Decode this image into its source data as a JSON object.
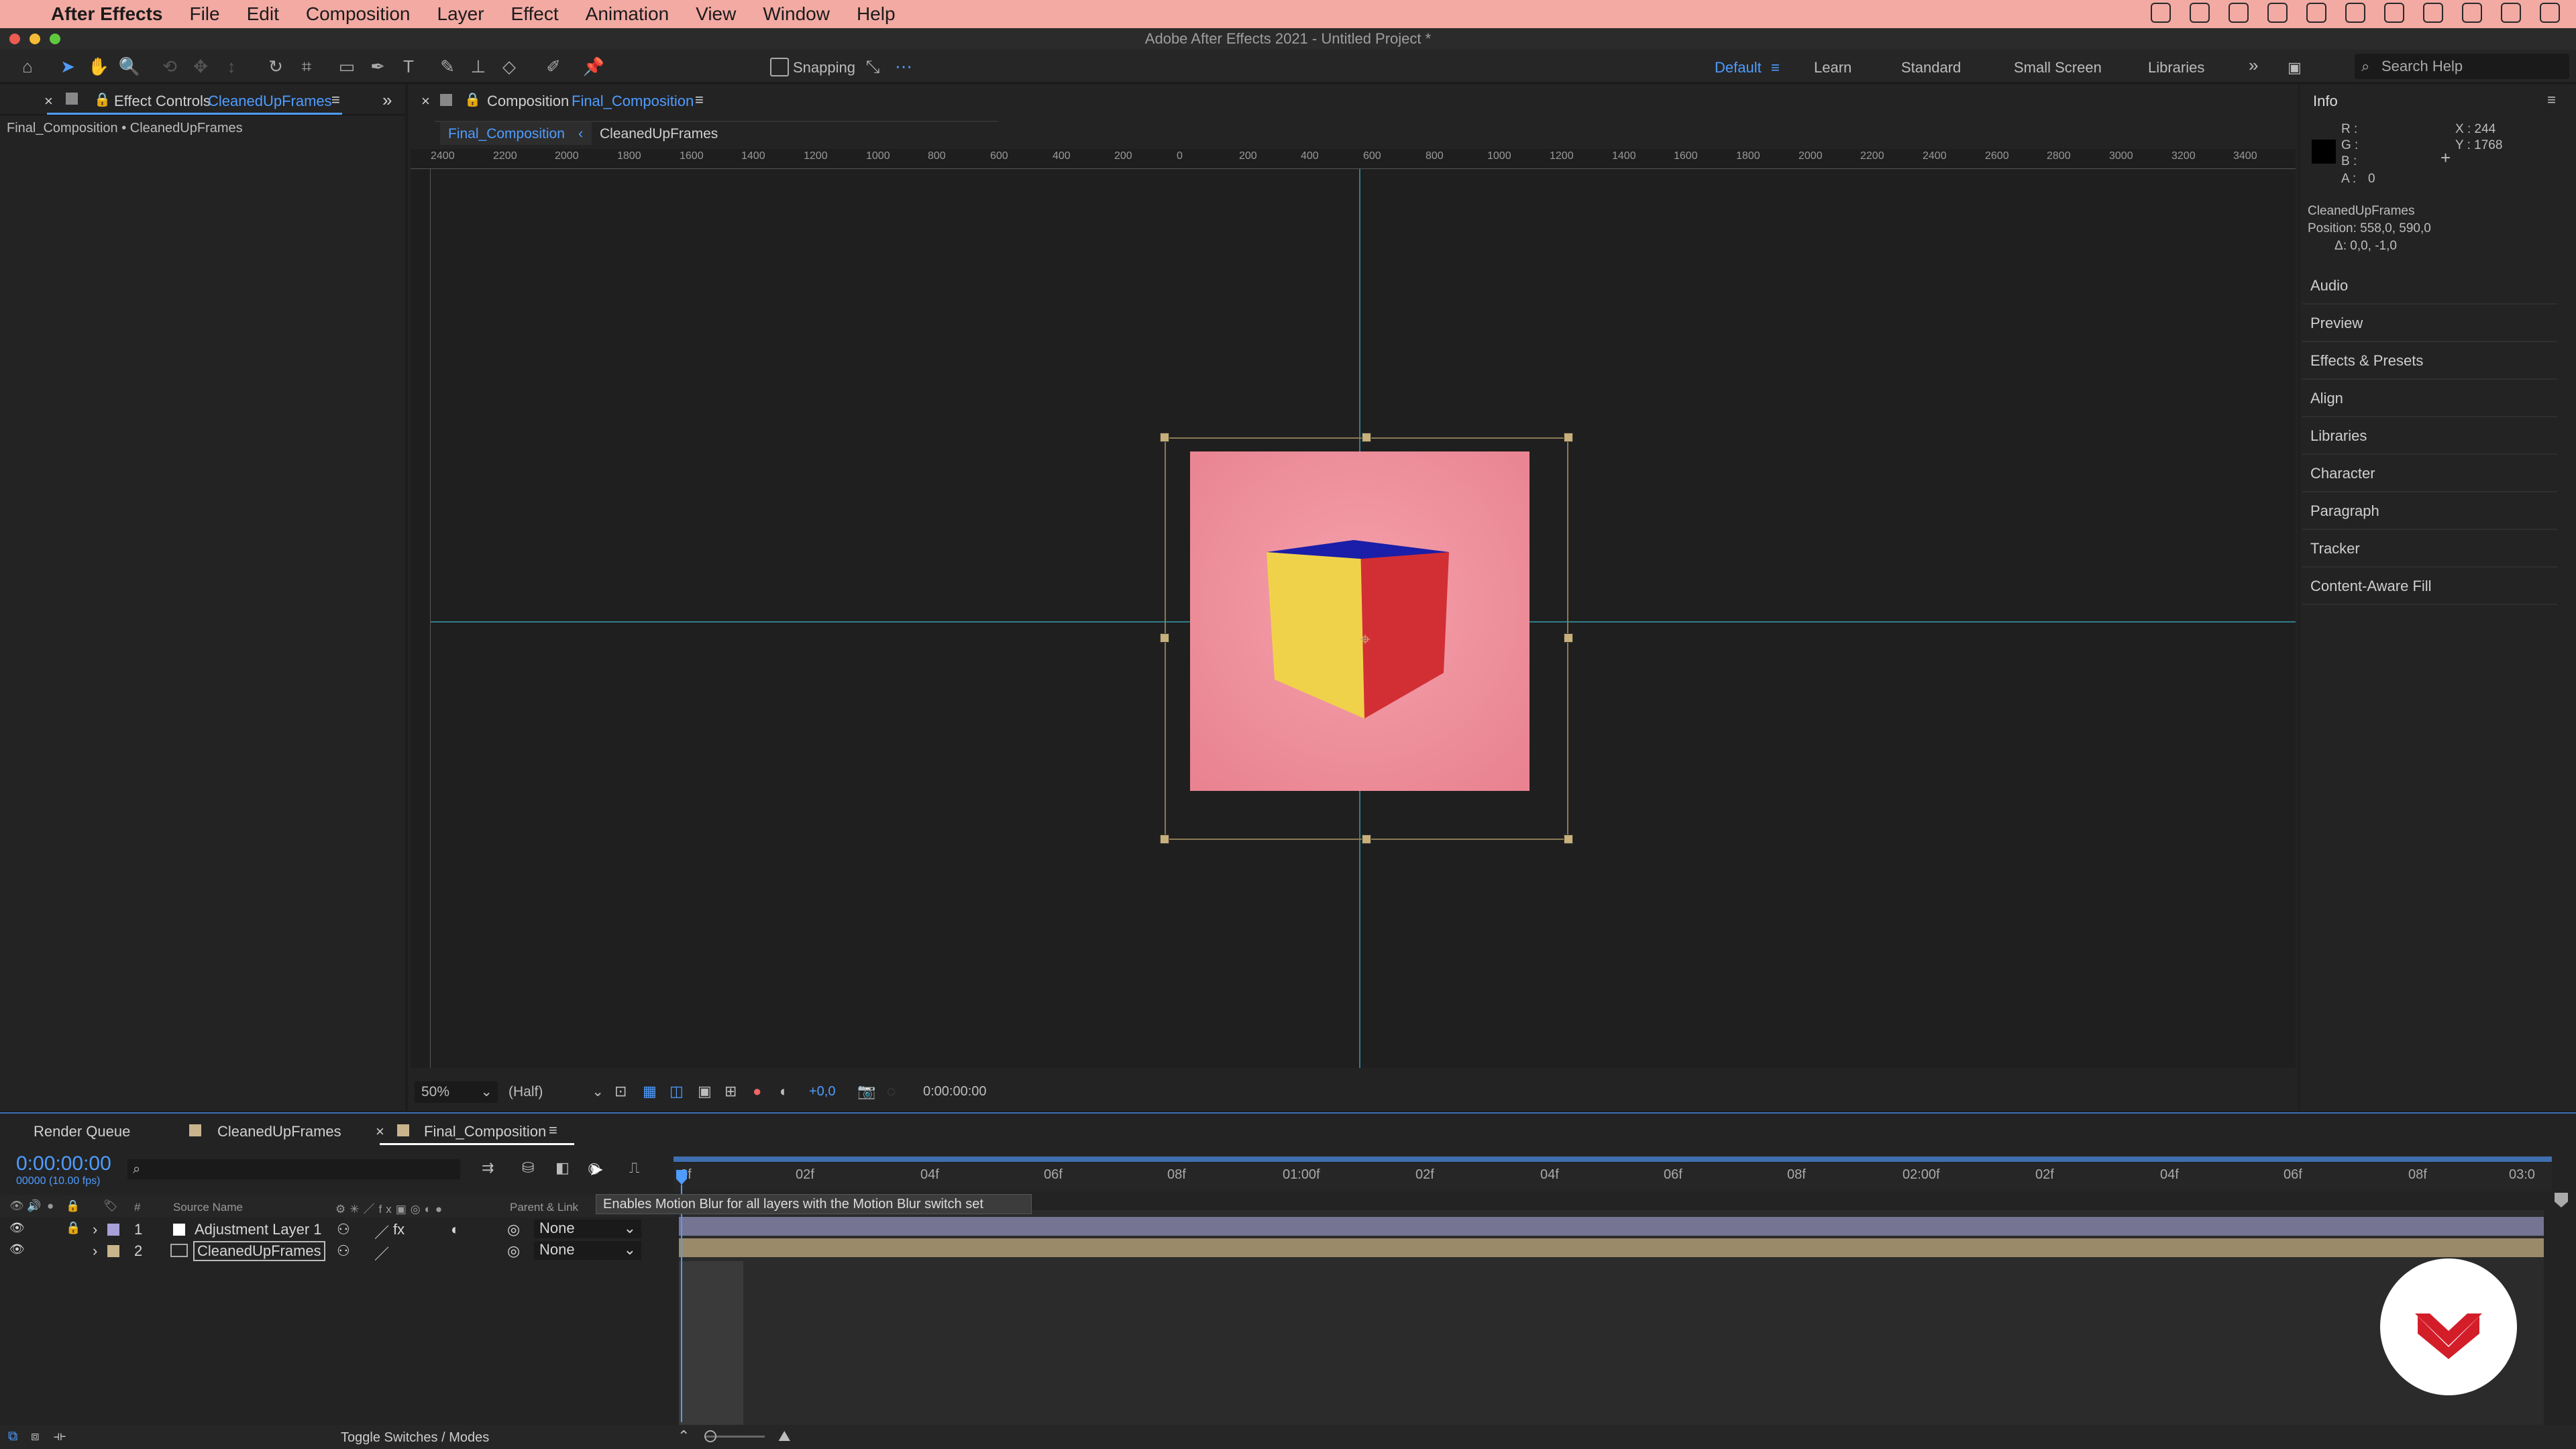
{
  "menubar": {
    "apple": "",
    "app": "After Effects",
    "items": [
      "File",
      "Edit",
      "Composition",
      "Layer",
      "Effect",
      "Animation",
      "View",
      "Window",
      "Help"
    ]
  },
  "window_title": "Adobe After Effects 2021 - Untitled Project *",
  "toolbar": {
    "snapping_label": "Snapping",
    "workspaces": [
      "Default",
      "Learn",
      "Standard",
      "Small Screen",
      "Libraries"
    ],
    "search_placeholder": "Search Help",
    "chevron": "»"
  },
  "effect_controls": {
    "tab_prefix": "Effect Controls",
    "tab_layer": "CleanedUpFrames",
    "breadcrumb": "Final_Composition • CleanedUpFrames"
  },
  "composition": {
    "tab_prefix": "Composition",
    "tab_name": "Final_Composition",
    "subtabs": [
      "Final_Composition",
      "CleanedUpFrames"
    ],
    "ruler_labels": [
      "2400",
      "2200",
      "2000",
      "1800",
      "1600",
      "1400",
      "1200",
      "1000",
      "800",
      "600",
      "400",
      "200",
      "0",
      "200",
      "400",
      "600",
      "800",
      "1000",
      "1200",
      "1400",
      "1600",
      "1800",
      "2000",
      "2200",
      "2400",
      "2600",
      "2800",
      "3000",
      "3200",
      "3400"
    ],
    "zoom": "50%",
    "resolution": "(Half)",
    "exposure": "+0,0",
    "timecode": "0:00:00:00"
  },
  "info": {
    "title": "Info",
    "r": "R :",
    "g": "G :",
    "b": "B :",
    "a_label": "A :",
    "a_value": "0",
    "x": "X : 244",
    "y": "Y : 1768",
    "layer_name": "CleanedUpFrames",
    "position": "Position: 558,0, 590,0",
    "delta": "Δ: 0,0, -1,0",
    "panels": [
      "Audio",
      "Preview",
      "Effects & Presets",
      "Align",
      "Libraries",
      "Character",
      "Paragraph",
      "Tracker",
      "Content-Aware Fill"
    ]
  },
  "timeline": {
    "tabs": [
      "Render Queue",
      "CleanedUpFrames",
      "Final_Composition"
    ],
    "current_time": "0:00:00:00",
    "frame_info": "00000 (10.00 fps)",
    "search_icon": "⌕",
    "col_source": "Source Name",
    "col_parent": "Parent & Link",
    "layers": [
      {
        "num": "1",
        "name": "Adjustment Layer 1",
        "parent": "None",
        "color": "#a8a0d8"
      },
      {
        "num": "2",
        "name": "CleanedUpFrames",
        "parent": "None",
        "color": "#c9b48c"
      }
    ],
    "ticks": [
      "0f",
      "02f",
      "04f",
      "06f",
      "08f",
      "01:00f",
      "02f",
      "04f",
      "06f",
      "08f",
      "02:00f",
      "02f",
      "04f",
      "06f",
      "08f",
      "03:0"
    ],
    "tooltip": "Enables Motion Blur for all layers with the Motion Blur switch set",
    "footer": "Toggle Switches / Modes"
  },
  "colors": {
    "accent": "#4f9cff",
    "canvas": "#ee8f9b",
    "menubar": "#f2aaa3"
  }
}
